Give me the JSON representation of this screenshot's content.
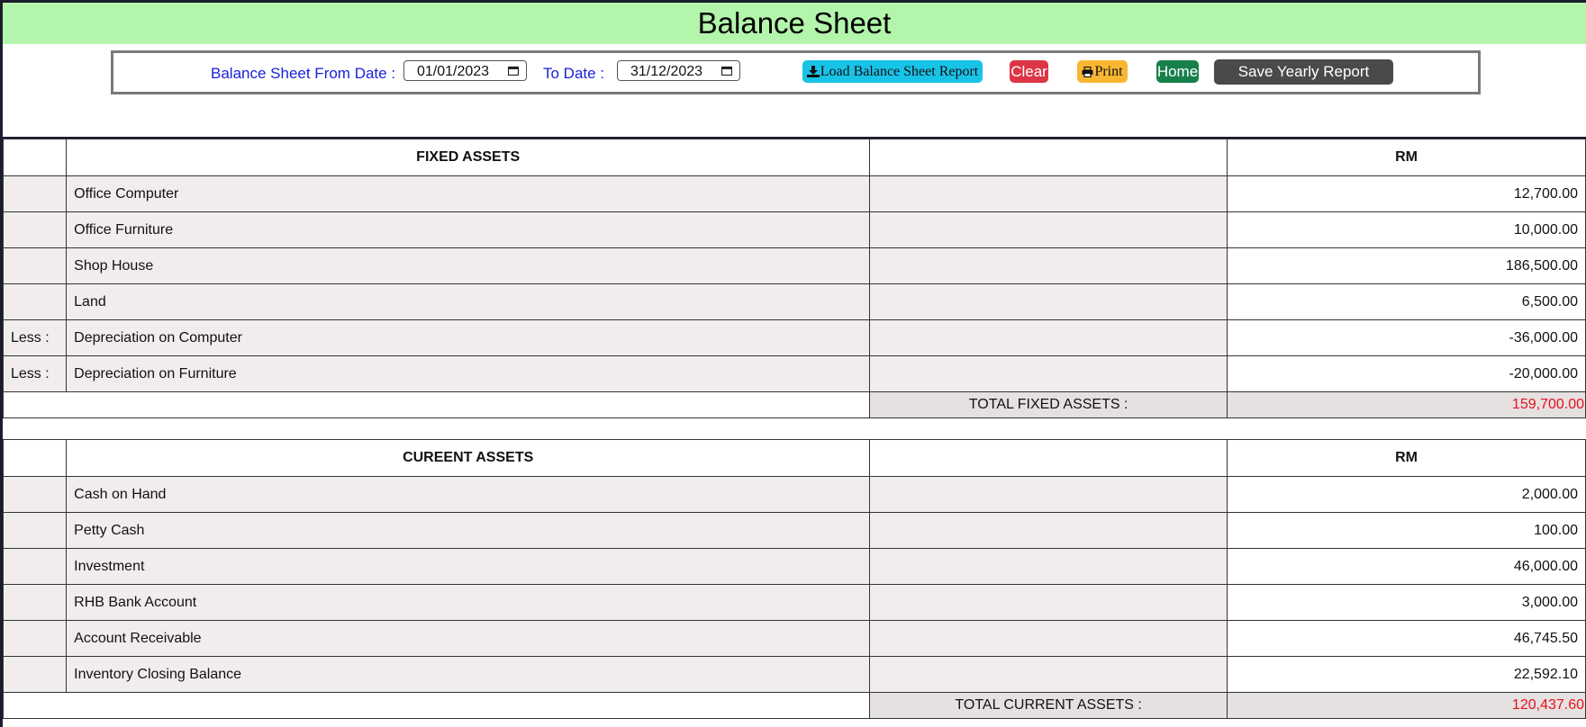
{
  "page": {
    "title": "Balance Sheet"
  },
  "toolbar": {
    "from_label": "Balance Sheet From Date :",
    "from_value": "01/01/2023",
    "to_label": "To Date :",
    "to_value": "31/12/2023",
    "load_label": "Load Balance Sheet Report",
    "clear_label": "Clear",
    "print_label": "Print",
    "home_label": "Home",
    "save_label": "Save Yearly Report",
    "colors": {
      "load": "#18c3e8",
      "clear": "#dc3545",
      "print": "#f7b731",
      "home": "#17804a",
      "save": "#4a4a4a"
    },
    "icons": {
      "load": "download-icon",
      "print": "print-icon",
      "date": "calendar-icon"
    }
  },
  "fixed_assets": {
    "header": "FIXED ASSETS",
    "currency_header": "RM",
    "rows": [
      {
        "prefix": "",
        "name": "Office Computer",
        "amount": "12,700.00"
      },
      {
        "prefix": "",
        "name": "Office Furniture",
        "amount": "10,000.00"
      },
      {
        "prefix": "",
        "name": "Shop House",
        "amount": "186,500.00"
      },
      {
        "prefix": "",
        "name": "Land",
        "amount": "6,500.00"
      },
      {
        "prefix": "Less :",
        "name": "Depreciation on Computer",
        "amount": "-36,000.00"
      },
      {
        "prefix": "Less :",
        "name": "Depreciation on Furniture",
        "amount": "-20,000.00"
      }
    ],
    "total_label": "TOTAL FIXED ASSETS :",
    "total_value": "159,700.00"
  },
  "current_assets": {
    "header": "CUREENT ASSETS",
    "currency_header": "RM",
    "rows": [
      {
        "prefix": "",
        "name": "Cash on Hand",
        "amount": "2,000.00"
      },
      {
        "prefix": "",
        "name": "Petty Cash",
        "amount": "100.00"
      },
      {
        "prefix": "",
        "name": "Investment",
        "amount": "46,000.00"
      },
      {
        "prefix": "",
        "name": "RHB Bank Account",
        "amount": "3,000.00"
      },
      {
        "prefix": "",
        "name": "Account Receivable",
        "amount": "46,745.50"
      },
      {
        "prefix": "",
        "name": "Inventory Closing Balance",
        "amount": "22,592.10"
      }
    ],
    "total_label": "TOTAL CURRENT ASSETS :",
    "total_value": "120,437.60"
  },
  "colors": {
    "title_bar": "#b3f5ab",
    "total_value": "#e8101c",
    "label_blue": "#1a22d6",
    "row_shade": "#f2eded",
    "total_shade": "#e6e1e1"
  }
}
